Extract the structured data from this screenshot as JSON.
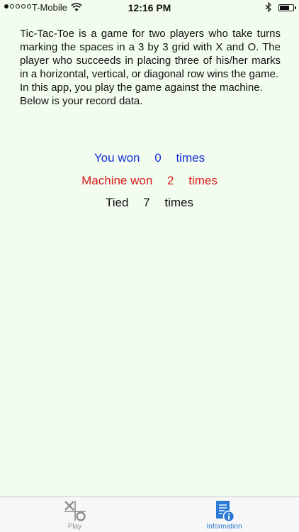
{
  "status_bar": {
    "carrier": "T-Mobile",
    "time": "12:16 PM",
    "signal_bars_filled": 1,
    "signal_bars_total": 5,
    "battery_level": 0.7
  },
  "description": {
    "paragraph1": "Tic-Tac-Toe is a game for two players who take turns marking the spaces in a 3 by 3 grid with X and O. The player who succeeds in placing three of his/her marks in a horizontal, vertical, or diagonal row wins the game.",
    "paragraph2": "In this app, you play the game against the machine. Below is your record data."
  },
  "stats": {
    "won": {
      "label": "You won",
      "count": "0",
      "suffix": "times",
      "color": "#1a2fd6"
    },
    "lost": {
      "label": "Machine won",
      "count": "2",
      "suffix": "times",
      "color": "#d81a1a"
    },
    "tied": {
      "label": "Tied",
      "count": "7",
      "suffix": "times",
      "color": "#111111"
    }
  },
  "tab_bar": {
    "tabs": [
      {
        "label": "Play",
        "icon": "tic-tac-toe-icon",
        "active": false
      },
      {
        "label": "Information",
        "icon": "info-document-icon",
        "active": true
      }
    ],
    "active_color": "#2a7ad6",
    "inactive_color": "#8e8e8e"
  }
}
